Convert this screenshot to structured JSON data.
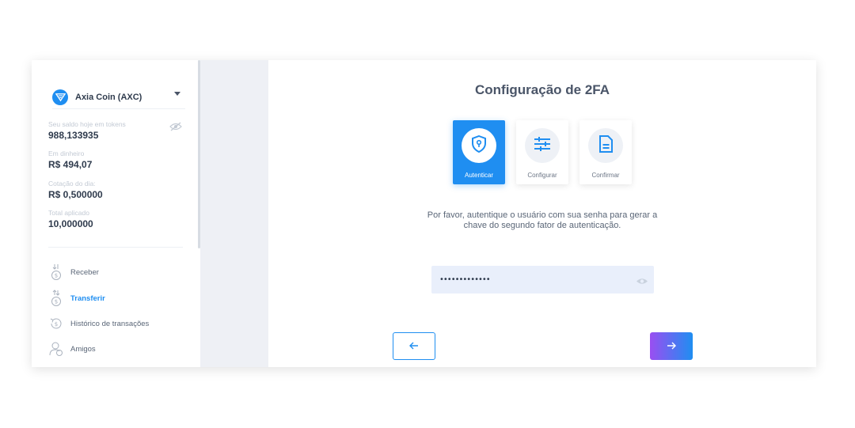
{
  "sidebar": {
    "coin_name": "Axia Coin (AXC)",
    "balances": [
      {
        "label": "Seu saldo hoje em tokens",
        "value": "988,133935"
      },
      {
        "label": "Em dinheiro",
        "value": "R$ 494,07"
      },
      {
        "label": "Cotação do dia:",
        "value": "R$ 0,500000"
      },
      {
        "label": "Total aplicado",
        "value": "10,000000"
      }
    ],
    "nav": [
      {
        "label": "Receber",
        "icon": "receive-icon"
      },
      {
        "label": "Transferir",
        "icon": "transfer-icon",
        "active": true
      },
      {
        "label": "Histórico de transações",
        "icon": "history-icon"
      },
      {
        "label": "Amigos",
        "icon": "friends-icon"
      }
    ]
  },
  "main": {
    "title": "Configuração de 2FA",
    "steps": [
      {
        "label": "Autenticar",
        "icon": "shield-lock-icon",
        "active": true
      },
      {
        "label": "Configurar",
        "icon": "sliders-icon",
        "active": false
      },
      {
        "label": "Confirmar",
        "icon": "document-icon",
        "active": false
      }
    ],
    "description": "Por favor, autentique o usuário com sua senha para gerar a chave do segundo fator de autenticação.",
    "password_value": "•••••••••••••",
    "back_icon": "arrow-left-icon",
    "next_icon": "arrow-right-icon"
  },
  "colors": {
    "accent": "#1f8ef1",
    "gradient_start": "#9a4ef1",
    "field_bg": "#e9effb",
    "panel_bg": "#eef0f5"
  }
}
